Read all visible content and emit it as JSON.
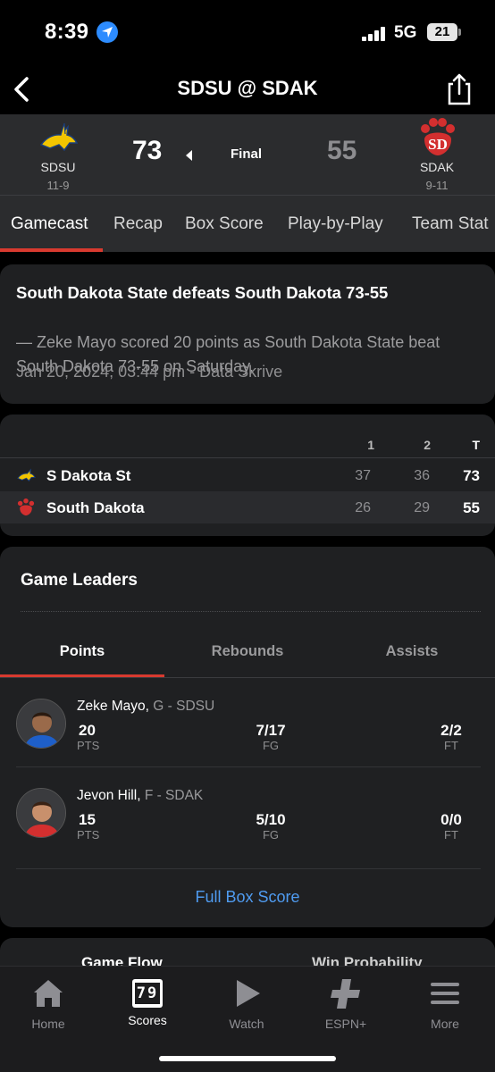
{
  "status_bar": {
    "time": "8:39",
    "network": "5G",
    "battery": "21"
  },
  "header": {
    "title": "SDSU @ SDAK",
    "back_icon": "chevron-left-icon",
    "share_icon": "share-icon"
  },
  "game": {
    "away": {
      "abbr": "SDSU",
      "record": "11-9",
      "score": "73",
      "color": "#f2c500"
    },
    "home": {
      "abbr": "SDAK",
      "record": "9-11",
      "score": "55",
      "color": "#d32f2f"
    },
    "status": "Final"
  },
  "tabs": [
    "Gamecast",
    "Recap",
    "Box Score",
    "Play-by-Play",
    "Team Stat"
  ],
  "story": {
    "title": "South Dakota State defeats South Dakota 73-55",
    "body": "— Zeke Mayo scored 20 points as South Dakota State beat South Dakota 73-55 on Saturday.",
    "meta": "Jan 20, 2024, 03:44 pm - Data Skrive"
  },
  "linescore": {
    "headers": [
      "1",
      "2",
      "T"
    ],
    "rows": [
      {
        "team": "S Dakota St",
        "q1": "37",
        "q2": "36",
        "total": "73"
      },
      {
        "team": "South Dakota",
        "q1": "26",
        "q2": "29",
        "total": "55"
      }
    ]
  },
  "leaders": {
    "title": "Game Leaders",
    "tabs": [
      "Points",
      "Rebounds",
      "Assists"
    ],
    "players": [
      {
        "name": "Zeke Mayo,",
        "pos": "G - SDSU",
        "stats": [
          {
            "value": "20",
            "label": "PTS"
          },
          {
            "value": "7/17",
            "label": "FG"
          },
          {
            "value": "2/2",
            "label": "FT"
          }
        ]
      },
      {
        "name": "Jevon Hill,",
        "pos": "F - SDAK",
        "stats": [
          {
            "value": "15",
            "label": "PTS"
          },
          {
            "value": "5/10",
            "label": "FG"
          },
          {
            "value": "0/0",
            "label": "FT"
          }
        ]
      }
    ],
    "full_box": "Full Box Score"
  },
  "flow": {
    "tabs": [
      "Game Flow",
      "Win Probability"
    ]
  },
  "tabbar": {
    "items": [
      {
        "label": "Home",
        "icon": "home-icon"
      },
      {
        "label": "Scores",
        "icon": "scoreboard-icon"
      },
      {
        "label": "Watch",
        "icon": "play-icon"
      },
      {
        "label": "ESPN+",
        "icon": "plus-icon"
      },
      {
        "label": "More",
        "icon": "menu-icon"
      }
    ],
    "scores_icon_text": "79"
  },
  "colors": {
    "accent": "#d83a2f",
    "link": "#4f9bf0",
    "card": "#1f2022"
  }
}
